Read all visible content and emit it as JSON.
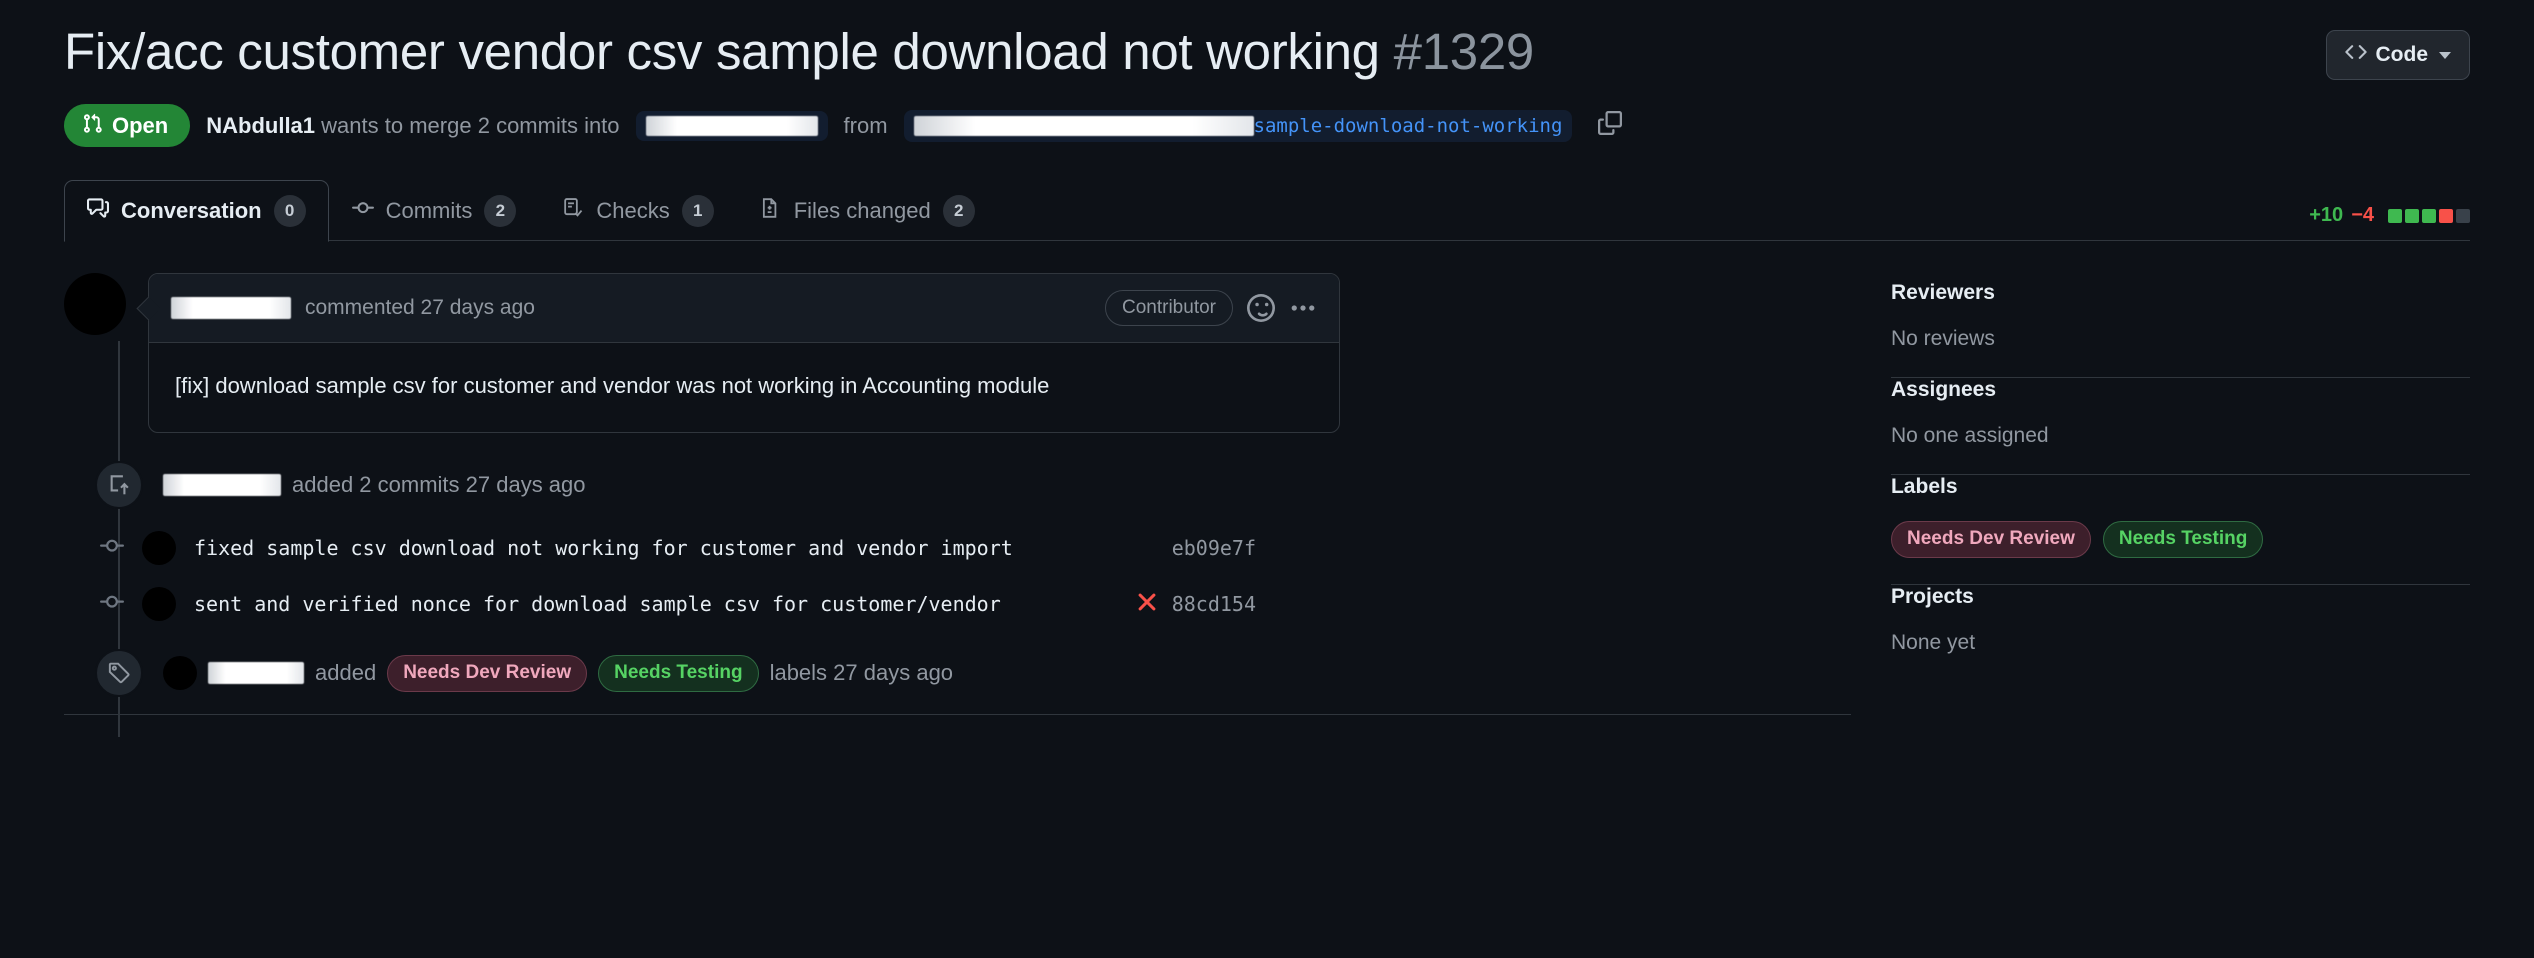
{
  "header": {
    "title": "Fix/acc customer vendor csv sample download not working",
    "number": "#1329",
    "code_button": "Code"
  },
  "status": {
    "state_label": "Open",
    "author": "NAbdulla1",
    "merge_text_prefix": "wants to merge",
    "commit_count": "2",
    "merge_text_middle": "commits into",
    "base_branch_redacted": "██████████████",
    "from_label": "from",
    "head_branch_redacted": "███████████████████████████",
    "head_branch_visible": "sample-download-not-working"
  },
  "tabs": [
    {
      "label": "Conversation",
      "count": "0",
      "active": true
    },
    {
      "label": "Commits",
      "count": "2",
      "active": false
    },
    {
      "label": "Checks",
      "count": "1",
      "active": false
    },
    {
      "label": "Files changed",
      "count": "2",
      "active": false
    }
  ],
  "diffstat": {
    "additions": "+10",
    "deletions": "−4",
    "blocks": [
      "g",
      "g",
      "g",
      "r",
      "n"
    ]
  },
  "comment": {
    "author_redacted": "██████████",
    "meta": "commented 27 days ago",
    "badge": "Contributor",
    "body": "[fix] download sample csv for customer and vendor was not working in Accounting module"
  },
  "timeline": {
    "commits_event": {
      "author_redacted": "██████████",
      "text": "added 2 commits 27 days ago"
    },
    "commits": [
      {
        "message": "fixed sample csv download not working for customer and vendor import",
        "sha": "eb09e7f",
        "status": "none"
      },
      {
        "message": "sent and verified nonce for download sample csv for customer/vendor",
        "sha": "88cd154",
        "status": "failure"
      }
    ],
    "labels_event": {
      "author_redacted": "████████",
      "verb": "added",
      "labels": [
        "Needs Dev Review",
        "Needs Testing"
      ],
      "suffix": "labels 27 days ago"
    }
  },
  "sidebar": {
    "reviewers": {
      "title": "Reviewers",
      "empty": "No reviews"
    },
    "assignees": {
      "title": "Assignees",
      "empty": "No one assigned"
    },
    "labels": {
      "title": "Labels",
      "items": [
        "Needs Dev Review",
        "Needs Testing"
      ]
    },
    "projects": {
      "title": "Projects",
      "empty": "None yet"
    }
  },
  "colors": {
    "open_green": "#238636",
    "additions": "#3fb950",
    "deletions": "#f85149",
    "link_blue": "#4493f8"
  }
}
